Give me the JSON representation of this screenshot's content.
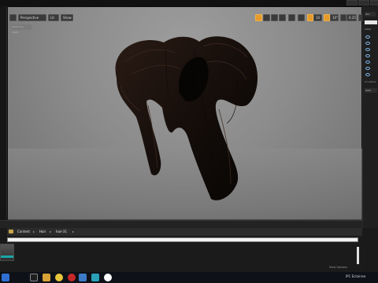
{
  "viewport": {
    "toolbar": {
      "perspective_label": "Perspective",
      "lit_label": "Lit",
      "show_label": "Show",
      "grid_value": "10",
      "angle_value": "10°",
      "scale_value": "0.25",
      "camera_speed": "1"
    },
    "stats_text": "Stationary Lights"
  },
  "right_panel": {
    "top_label": "Wor",
    "search_label": "Label",
    "actor_count": "17 actors",
    "details_label": "Deta"
  },
  "content_browser": {
    "breadcrumb": [
      "Content",
      "Hair",
      "hair-31"
    ],
    "view_options_label": "View Options"
  },
  "taskbar": {
    "tray_text": "IPC  Eclairsse"
  },
  "colors": {
    "accent": "#e59a2a",
    "viewport_bg": "#8c8c8c",
    "thumbnail_stripe": "#1ba4a6"
  }
}
